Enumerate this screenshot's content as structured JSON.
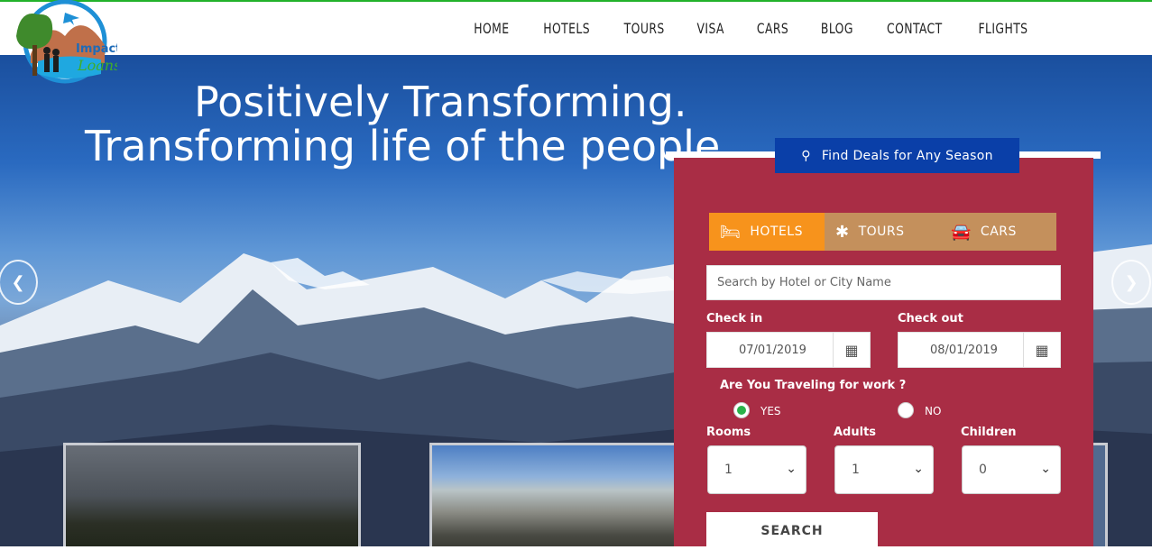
{
  "header": {
    "logo_text_top": "Impact",
    "logo_text_bottom": "Loans",
    "nav": [
      "HOME",
      "HOTELS",
      "TOURS",
      "VISA",
      "CARS",
      "BLOG",
      "CONTACT",
      "FLIGHTS"
    ]
  },
  "hero": {
    "line1": "Positively Transforming.",
    "line2": "Transforming life of the people"
  },
  "search": {
    "title": "Find Deals for Any Season",
    "tabs": [
      {
        "label": "HOTELS",
        "icon": "bed-icon",
        "active": true
      },
      {
        "label": "TOURS",
        "icon": "asterisk-icon",
        "active": false
      },
      {
        "label": "CARS",
        "icon": "car-icon",
        "active": false
      }
    ],
    "hotel_placeholder": "Search by Hotel or City Name",
    "checkin_label": "Check in",
    "checkin_value": "07/01/2019",
    "checkout_label": "Check out",
    "checkout_value": "08/01/2019",
    "work_question": "Are You Traveling for work ?",
    "work_yes": "YES",
    "work_no": "NO",
    "work_selected": "YES",
    "rooms_label": "Rooms",
    "rooms_value": "1",
    "adults_label": "Adults",
    "adults_value": "1",
    "children_label": "Children",
    "children_value": "0",
    "search_button": "SEARCH"
  },
  "colors": {
    "accent_green": "#22b22a",
    "panel_red": "#a92d45",
    "tab_active": "#f7931c",
    "tab_bar": "#c4905c",
    "title_blue": "#0a3fa8"
  }
}
